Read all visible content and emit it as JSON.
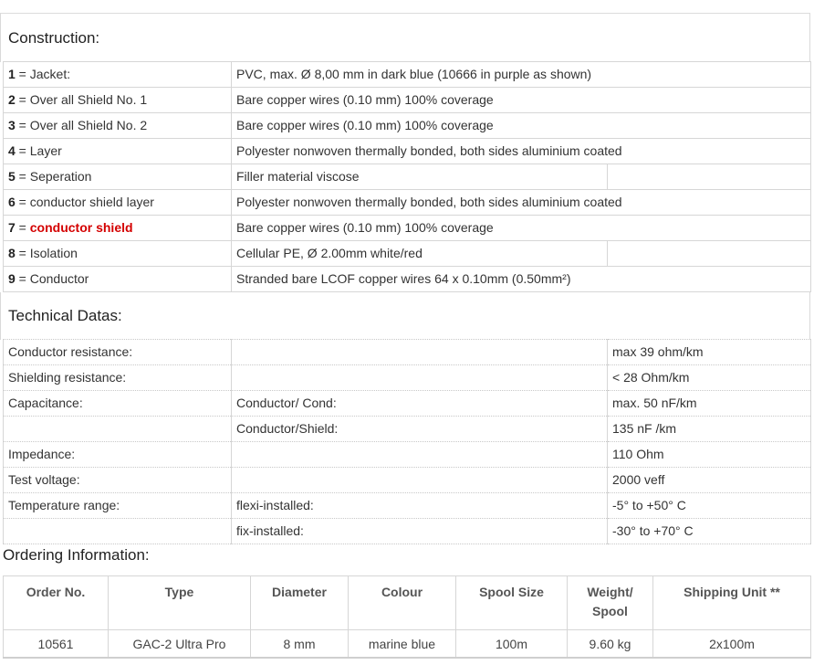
{
  "construction": {
    "title": "Construction:",
    "rows": [
      {
        "num": "1",
        "label": " = Jacket:",
        "desc": "PVC, max. Ø 8,00 mm in dark blue  (10666 in purple as shown)"
      },
      {
        "num": "2",
        "label": " = Over all Shield No. 1",
        "desc": "Bare copper wires (0.10 mm) 100% coverage"
      },
      {
        "num": "3",
        "label": " = Over all Shield No. 2",
        "desc": "Bare copper wires (0.10 mm) 100% coverage"
      },
      {
        "num": "4",
        "label": " = Layer",
        "desc": "Polyester nonwoven thermally bonded, both sides aluminium coated"
      },
      {
        "num": "5",
        "label": " = Seperation",
        "desc": "Filler material viscose"
      },
      {
        "num": "6",
        "label": " = conductor shield layer",
        "desc": "Polyester nonwoven thermally bonded, both sides aluminium coated"
      },
      {
        "num": "7",
        "label": " = ",
        "label_highlight": "conductor shield",
        "desc": "Bare copper wires (0.10 mm) 100% coverage"
      },
      {
        "num": "8",
        "label": " = Isolation",
        "desc": "Cellular PE, Ø 2.00mm white/red"
      },
      {
        "num": "9",
        "label": " = Conductor",
        "desc": "Stranded bare LCOF copper wires 64 x 0.10mm (0.50mm²)"
      }
    ]
  },
  "technical": {
    "title": "Technical Datas:",
    "rows": [
      {
        "param": "Conductor resistance:",
        "condition": "",
        "value": " max 39 ohm/km"
      },
      {
        "param": "Shielding resistance:",
        "condition": "",
        "value": " < 28 Ohm/km"
      },
      {
        "param": "Capacitance:",
        "condition": "Conductor/ Cond:",
        "value": " max. 50 nF/km"
      },
      {
        "param": "",
        "condition": "Conductor/Shield:",
        "value": "135 nF /km"
      },
      {
        "param": "Impedance:",
        "condition": "",
        "value": "110 Ohm"
      },
      {
        "param": "Test voltage:",
        "condition": "",
        "value": "2000 veff"
      },
      {
        "param": "Temperature range:",
        "condition": "flexi-installed:",
        "value": "-5° to +50° C"
      },
      {
        "param": "",
        "condition": "fix-installed:",
        "value": "-30° to +70° C"
      }
    ]
  },
  "ordering": {
    "title": "Ordering Information:",
    "headers": {
      "order_no": "Order No.",
      "type": "Type",
      "diameter": "Diameter",
      "colour": "Colour",
      "spool_size": "Spool Size",
      "weight_line1": "Weight/",
      "weight_line2": "Spool",
      "shipping": "Shipping Unit **"
    },
    "row": {
      "order_no": "10561",
      "type": "GAC-2 Ultra Pro",
      "diameter": "8 mm",
      "colour": "marine blue",
      "spool_size": "100m",
      "weight": "9.60 kg",
      "shipping": "2x100m"
    }
  }
}
